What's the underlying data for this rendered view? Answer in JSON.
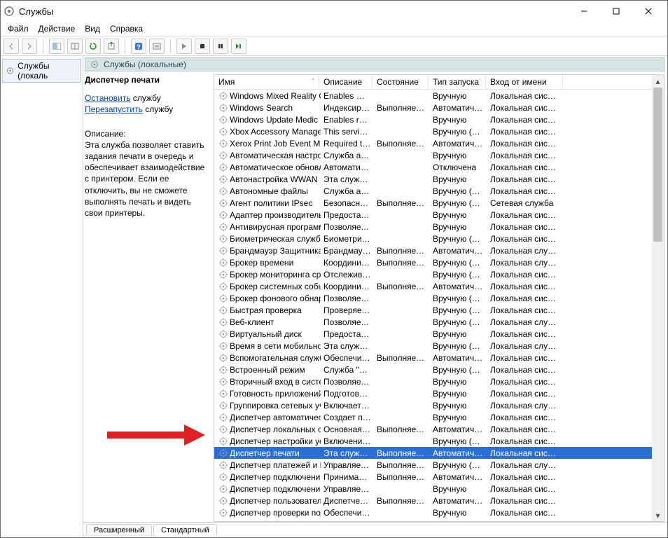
{
  "window": {
    "title": "Службы"
  },
  "menu": {
    "file": "Файл",
    "action": "Действие",
    "view": "Вид",
    "help": "Справка"
  },
  "tree": {
    "root": "Службы (локаль"
  },
  "paneHeader": "Службы (локальные)",
  "details": {
    "selected": "Диспетчер печати",
    "action_stop": "Остановить",
    "action_restart": "Перезапустить",
    "action_suffix": " службу",
    "desc_label": "Описание:",
    "desc_text": "Эта служба позволяет ставить задания печати в очередь и обеспечивает взаимодействие с принтером. Если ее отключить, вы не сможете выполнять печать и видеть свои принтеры."
  },
  "columns": {
    "name": "Имя",
    "desc": "Описание",
    "state": "Состояние",
    "start": "Тип запуска",
    "logon": "Вход от имени"
  },
  "tabs": {
    "extended": "Расширенный",
    "standard": "Стандартный"
  },
  "services": [
    {
      "name": "Windows Mixed Reality Op…",
      "desc": "Enables Mi…",
      "state": "",
      "start": "Вручную",
      "logon": "Локальная сис…"
    },
    {
      "name": "Windows Search",
      "desc": "Индексир…",
      "state": "Выполняется",
      "start": "Автоматиче…",
      "logon": "Локальная сис…"
    },
    {
      "name": "Windows Update Medic Ser…",
      "desc": "Enables re…",
      "state": "",
      "start": "Вручную",
      "logon": "Локальная сис…"
    },
    {
      "name": "Xbox Accessory Manageme…",
      "desc": "This servic…",
      "state": "",
      "start": "Вручную (ак…",
      "logon": "Локальная сис…"
    },
    {
      "name": "Xerox Print Job Event Mana…",
      "desc": "Required t…",
      "state": "Выполняется",
      "start": "Автоматиче…",
      "logon": "Локальная сис…"
    },
    {
      "name": "Автоматическая настройк…",
      "desc": "Служба ав…",
      "state": "",
      "start": "Вручную",
      "logon": "Локальная сис…"
    },
    {
      "name": "Автоматическое обновле…",
      "desc": "Автомати…",
      "state": "",
      "start": "Отключена",
      "logon": "Локальная сис…"
    },
    {
      "name": "Автонастройка WWAN",
      "desc": "Эта служб…",
      "state": "",
      "start": "Вручную",
      "logon": "Локальная сис…"
    },
    {
      "name": "Автономные файлы",
      "desc": "Служба ав…",
      "state": "",
      "start": "Вручную (ак…",
      "logon": "Локальная сис…"
    },
    {
      "name": "Агент политики IPsec",
      "desc": "Безопасно…",
      "state": "Выполняется",
      "start": "Вручную (ак…",
      "logon": "Сетевая служба"
    },
    {
      "name": "Адаптер производительно…",
      "desc": "Предостав…",
      "state": "",
      "start": "Вручную",
      "logon": "Локальная сис…"
    },
    {
      "name": "Антивирусная программа …",
      "desc": "Позволяет…",
      "state": "",
      "start": "Вручную",
      "logon": "Локальная сис…"
    },
    {
      "name": "Биометрическая служба …",
      "desc": "Биометри…",
      "state": "",
      "start": "Вручную (ак…",
      "logon": "Локальная сис…"
    },
    {
      "name": "Брандмауэр Защитника W…",
      "desc": "Брандмау…",
      "state": "Выполняется",
      "start": "Автоматиче…",
      "logon": "Локальная слу…"
    },
    {
      "name": "Брокер времени",
      "desc": "Координи…",
      "state": "Выполняется",
      "start": "Вручную (ак…",
      "logon": "Локальная слу…"
    },
    {
      "name": "Брокер мониторинга сред…",
      "desc": "Отслежив…",
      "state": "",
      "start": "Вручную (ак…",
      "logon": "Локальная сис…"
    },
    {
      "name": "Брокер системных событий",
      "desc": "Координи…",
      "state": "Выполняется",
      "start": "Автоматиче…",
      "logon": "Локальная сис…"
    },
    {
      "name": "Брокер фонового обнару…",
      "desc": "Позволяет…",
      "state": "",
      "start": "Вручную (ак…",
      "logon": "Локальная сис…"
    },
    {
      "name": "Быстрая проверка",
      "desc": "Проверяет…",
      "state": "",
      "start": "Вручную (ак…",
      "logon": "Локальная сис…"
    },
    {
      "name": "Веб-клиент",
      "desc": "Позволяет…",
      "state": "",
      "start": "Вручную (ак…",
      "logon": "Локальная слу…"
    },
    {
      "name": "Виртуальный диск",
      "desc": "Предостав…",
      "state": "",
      "start": "Вручную",
      "logon": "Локальная сис…"
    },
    {
      "name": "Время в сети мобильной с…",
      "desc": "Эта служб…",
      "state": "",
      "start": "Вручную (ак…",
      "logon": "Локальная слу…"
    },
    {
      "name": "Вспомогательная служба IP",
      "desc": "Обеспечи…",
      "state": "Выполняется",
      "start": "Автоматиче…",
      "logon": "Локальная сис…"
    },
    {
      "name": "Встроенный режим",
      "desc": "Служба \"В…",
      "state": "",
      "start": "Вручную (ак…",
      "logon": "Локальная сис…"
    },
    {
      "name": "Вторичный вход в систему",
      "desc": "Позволяет…",
      "state": "",
      "start": "Вручную",
      "logon": "Локальная сис…"
    },
    {
      "name": "Готовность приложений",
      "desc": "Подготовк…",
      "state": "",
      "start": "Вручную",
      "logon": "Локальная сис…"
    },
    {
      "name": "Группировка сетевых учас…",
      "desc": "Включает …",
      "state": "",
      "start": "Вручную",
      "logon": "Локальная слу…"
    },
    {
      "name": "Диспетчер автоматически…",
      "desc": "Создает п…",
      "state": "",
      "start": "Вручную",
      "logon": "Локальная сис…"
    },
    {
      "name": "Диспетчер локальных сеа…",
      "desc": "Основная …",
      "state": "Выполняется",
      "start": "Автоматиче…",
      "logon": "Локальная сис…"
    },
    {
      "name": "Диспетчер настройки устр…",
      "desc": "Включени…",
      "state": "",
      "start": "Вручную (ак…",
      "logon": "Локальная сис…"
    },
    {
      "name": "Диспетчер печати",
      "desc": "Эта служб…",
      "state": "Выполняется",
      "start": "Автоматиче…",
      "logon": "Локальная сис…",
      "selected": true
    },
    {
      "name": "Диспетчер платежей и NF…",
      "desc": "Управляет…",
      "state": "Выполняется",
      "start": "Вручную (ак…",
      "logon": "Локальная слу…"
    },
    {
      "name": "Диспетчер подключений …",
      "desc": "Принимае…",
      "state": "Выполняется",
      "start": "Автоматиче…",
      "logon": "Локальная сис…"
    },
    {
      "name": "Диспетчер подключений …",
      "desc": "Управляет…",
      "state": "",
      "start": "Вручную",
      "logon": "Локальная сис…"
    },
    {
      "name": "Диспетчер пользователей",
      "desc": "Диспетчер…",
      "state": "Выполняется",
      "start": "Автоматиче…",
      "logon": "Локальная сис…"
    },
    {
      "name": "Диспетчер проверки подл…",
      "desc": "Обеспечи…",
      "state": "",
      "start": "Вручную",
      "logon": "Локальная сис…"
    }
  ]
}
